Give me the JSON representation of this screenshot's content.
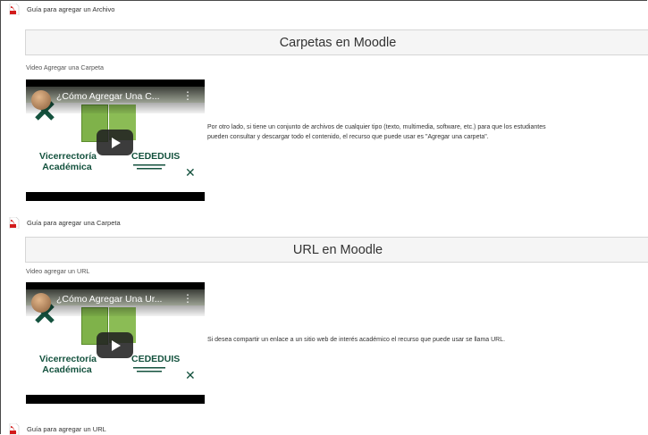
{
  "colors": {
    "pdf_icon": "#d21b1b",
    "heading_bg": "#f5f5f5",
    "heading_border": "#d6d6d6",
    "thumb_green": "#7fb24a",
    "thumb_text": "#14523e"
  },
  "resources_top": {
    "archivo_guide": {
      "icon": "pdf-icon",
      "label": "Guía para agregar un Archivo"
    }
  },
  "sections": [
    {
      "heading": "Carpetas en Moodle",
      "video_label": "Video  Agregar una Carpeta",
      "video": {
        "title": "¿Cómo Agregar Una C...",
        "vice_line1": "Vicerrectoría",
        "vice_line2": "Académica",
        "logo_text": "CEDEDUIS",
        "play_icon": "play-icon",
        "menu_icon": "kebab-menu-icon"
      },
      "description_line1": "Por otro lado, si tiene un conjunto de archivos de cualquier tipo (texto, multimedia, software, etc.) para que los estudiantes",
      "description_line2": "pueden consultar y descargar todo el contenido, el recurso que puede usar es \"Agregar una carpeta\".",
      "guide": {
        "icon": "pdf-icon",
        "label": "Guía para agregar una Carpeta"
      }
    },
    {
      "heading": "URL en Moodle",
      "video_label": "Video agregar un URL",
      "video": {
        "title": "¿Cómo Agregar Una Ur...",
        "vice_line1": "Vicerrectoría",
        "vice_line2": "Académica",
        "logo_text": "CEDEDUIS",
        "play_icon": "play-icon",
        "menu_icon": "kebab-menu-icon"
      },
      "description_line1": "Si desea compartir un enlace  a un sitio web de interés académico el recurso que puede usar se llama URL.",
      "description_line2": "",
      "guide": {
        "icon": "pdf-icon",
        "label": "Guía para agregar un URL"
      }
    }
  ]
}
